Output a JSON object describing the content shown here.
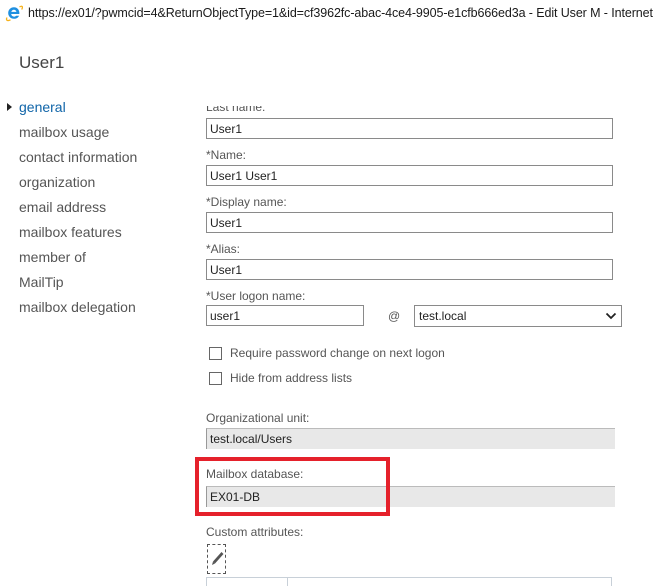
{
  "window": {
    "title": "https://ex01/?pwmcid=4&ReturnObjectType=1&id=cf3962fc-abac-4ce4-9905-e1cfb666ed3a - Edit User M - Internet Explorer",
    "icon": "internet-explorer-icon"
  },
  "page": {
    "title": "User1"
  },
  "nav": {
    "items": [
      {
        "label": "general",
        "active": true
      },
      {
        "label": "mailbox usage",
        "active": false
      },
      {
        "label": "contact information",
        "active": false
      },
      {
        "label": "organization",
        "active": false
      },
      {
        "label": "email address",
        "active": false
      },
      {
        "label": "mailbox features",
        "active": false
      },
      {
        "label": "member of",
        "active": false
      },
      {
        "label": "MailTip",
        "active": false
      },
      {
        "label": "mailbox delegation",
        "active": false
      }
    ]
  },
  "form": {
    "last_name": {
      "label": "Last name:",
      "value": "User1"
    },
    "name": {
      "label": "*Name:",
      "value": "User1 User1"
    },
    "display_name": {
      "label": "*Display name:",
      "value": "User1"
    },
    "alias": {
      "label": "*Alias:",
      "value": "User1"
    },
    "logon_name": {
      "label": "*User logon name:",
      "value": "user1",
      "at": "@",
      "domain": "test.local"
    },
    "require_password_change": {
      "label": "Require password change on next logon",
      "checked": false
    },
    "hide_from_address_lists": {
      "label": "Hide from address lists",
      "checked": false
    },
    "organizational_unit": {
      "label": "Organizational unit:",
      "value": "test.local/Users"
    },
    "mailbox_database": {
      "label": "Mailbox database:",
      "value": "EX01-DB"
    },
    "custom_attributes": {
      "label": "Custom attributes:",
      "edit_icon": "pencil-icon"
    }
  },
  "annotation": {
    "highlight_color": "#e5212b",
    "highlight_target": "mailbox_database"
  },
  "colors": {
    "nav_active": "#0f64a8",
    "nav_text": "#555555",
    "readonly_bg": "#e8e8e8"
  }
}
